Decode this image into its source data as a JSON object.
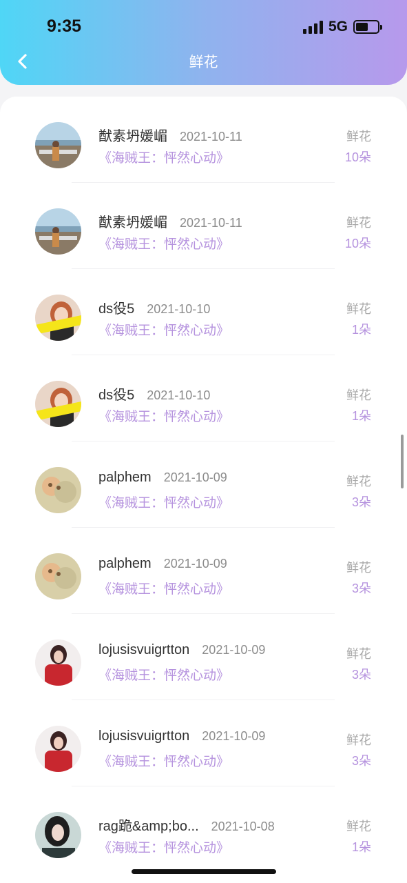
{
  "status_bar": {
    "time": "9:35",
    "network": "5G",
    "battery_level": 0.58
  },
  "header": {
    "title": "鲜花",
    "back_icon": "chevron-left-icon"
  },
  "colors": {
    "accent": "#b592de",
    "header_start": "#4fd6f6",
    "header_end": "#b799ec"
  },
  "records": [
    {
      "name": "猷素坍媛嵋",
      "date": "2021-10-11",
      "work": "《海贼王：怦然心动》",
      "gift_label": "鲜花",
      "gift_count": "10朵",
      "avatar": "avatar-seaside"
    },
    {
      "name": "猷素坍媛嵋",
      "date": "2021-10-11",
      "work": "《海贼王：怦然心动》",
      "gift_label": "鲜花",
      "gift_count": "10朵",
      "avatar": "avatar-seaside"
    },
    {
      "name": "ds役5",
      "date": "2021-10-10",
      "work": "《海贼王：怦然心动》",
      "gift_label": "鲜花",
      "gift_count": "1朵",
      "avatar": "avatar-girl-banner"
    },
    {
      "name": "ds役5",
      "date": "2021-10-10",
      "work": "《海贼王：怦然心动》",
      "gift_label": "鲜花",
      "gift_count": "1朵",
      "avatar": "avatar-girl-banner"
    },
    {
      "name": "palphem",
      "date": "2021-10-09",
      "work": "《海贼王：怦然心动》",
      "gift_label": "鲜花",
      "gift_count": "3朵",
      "avatar": "avatar-blurry-cat"
    },
    {
      "name": "palphem",
      "date": "2021-10-09",
      "work": "《海贼王：怦然心动》",
      "gift_label": "鲜花",
      "gift_count": "3朵",
      "avatar": "avatar-blurry-cat"
    },
    {
      "name": "lojusisvuigrtton",
      "date": "2021-10-09",
      "work": "《海贼王：怦然心动》",
      "gift_label": "鲜花",
      "gift_count": "3朵",
      "avatar": "avatar-red-coat"
    },
    {
      "name": "lojusisvuigrtton",
      "date": "2021-10-09",
      "work": "《海贼王：怦然心动》",
      "gift_label": "鲜花",
      "gift_count": "3朵",
      "avatar": "avatar-red-coat"
    },
    {
      "name": "rag跪&amp;bo...",
      "date": "2021-10-08",
      "work": "《海贼王：怦然心动》",
      "gift_label": "鲜花",
      "gift_count": "1朵",
      "avatar": "avatar-dark-hair"
    }
  ]
}
